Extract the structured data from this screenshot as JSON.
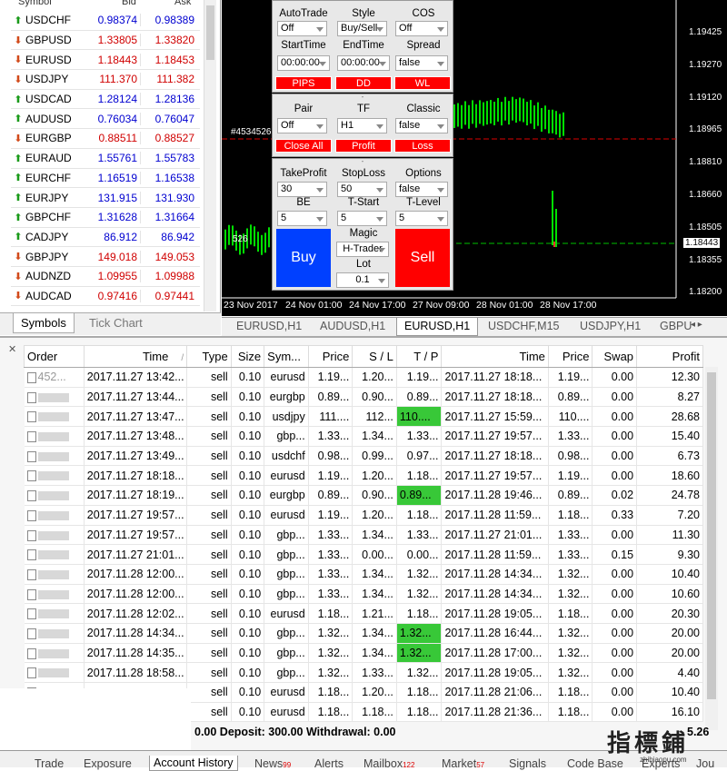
{
  "market_watch": {
    "columns": {
      "symbol": "Symbol",
      "bid": "Bid",
      "ask": "Ask"
    },
    "rows": [
      {
        "dir": "up",
        "symbol": "USDCHF",
        "bid": "0.98374",
        "ask": "0.98389",
        "color": "blue"
      },
      {
        "dir": "down",
        "symbol": "GBPUSD",
        "bid": "1.33805",
        "ask": "1.33820",
        "color": "red"
      },
      {
        "dir": "down",
        "symbol": "EURUSD",
        "bid": "1.18443",
        "ask": "1.18453",
        "color": "red"
      },
      {
        "dir": "down",
        "symbol": "USDJPY",
        "bid": "111.370",
        "ask": "111.382",
        "color": "red"
      },
      {
        "dir": "up",
        "symbol": "USDCAD",
        "bid": "1.28124",
        "ask": "1.28136",
        "color": "blue"
      },
      {
        "dir": "up",
        "symbol": "AUDUSD",
        "bid": "0.76034",
        "ask": "0.76047",
        "color": "blue"
      },
      {
        "dir": "down",
        "symbol": "EURGBP",
        "bid": "0.88511",
        "ask": "0.88527",
        "color": "red"
      },
      {
        "dir": "up",
        "symbol": "EURAUD",
        "bid": "1.55761",
        "ask": "1.55783",
        "color": "blue"
      },
      {
        "dir": "up",
        "symbol": "EURCHF",
        "bid": "1.16519",
        "ask": "1.16538",
        "color": "blue"
      },
      {
        "dir": "up",
        "symbol": "EURJPY",
        "bid": "131.915",
        "ask": "131.930",
        "color": "blue"
      },
      {
        "dir": "up",
        "symbol": "GBPCHF",
        "bid": "1.31628",
        "ask": "1.31664",
        "color": "blue"
      },
      {
        "dir": "up",
        "symbol": "CADJPY",
        "bid": "86.912",
        "ask": "86.942",
        "color": "blue"
      },
      {
        "dir": "down",
        "symbol": "GBPJPY",
        "bid": "149.018",
        "ask": "149.053",
        "color": "red"
      },
      {
        "dir": "down",
        "symbol": "AUDNZD",
        "bid": "1.09955",
        "ask": "1.09988",
        "color": "red"
      },
      {
        "dir": "down",
        "symbol": "AUDCAD",
        "bid": "0.97416",
        "ask": "0.97441",
        "color": "red"
      }
    ],
    "tabs": [
      "Symbols",
      "Tick Chart"
    ]
  },
  "chart": {
    "price_labels": [
      "1.19425",
      "1.19270",
      "1.19120",
      "1.18965",
      "1.18810",
      "1.18660",
      "1.18505",
      "1.18355",
      "1.18200"
    ],
    "current_price": "1.18443",
    "time_labels": [
      "23 Nov 2017",
      "24 Nov 01:00",
      "24 Nov 17:00",
      "27 Nov 09:00",
      "28 Nov 01:00",
      "28 Nov 17:00"
    ],
    "order_label": "#4534526",
    "side_label": "526"
  },
  "panel": {
    "labels1": [
      "AutoTrade",
      "Style",
      "COS"
    ],
    "values1": [
      "Off",
      "Buy/Sell",
      "Off"
    ],
    "labels2": [
      "StartTime",
      "EndTime",
      "Spread"
    ],
    "values2": [
      "00:00:00",
      "00:00:00",
      "false"
    ],
    "buttons1": [
      "PIPS",
      "DD",
      "WL"
    ],
    "labels3": [
      "Pair",
      "TF",
      "Classic"
    ],
    "values3": [
      "Off",
      "H1",
      "false"
    ],
    "buttons2": [
      "Close All",
      "Profit",
      "Loss"
    ],
    "labels4": [
      "TakeProfit",
      "StopLoss",
      "Options"
    ],
    "values4": [
      "30",
      "50",
      "false"
    ],
    "labels5": [
      "BE",
      "T-Start",
      "T-Level"
    ],
    "values5": [
      "5",
      "5",
      "5"
    ],
    "magic_label": "Magic",
    "magic_value": "H-Trader",
    "lot_label": "Lot",
    "lot_value": "0.1",
    "buy": "Buy",
    "sell": "Sell",
    "dash": "-"
  },
  "chart_tabs": [
    "EURUSD,H1",
    "AUDUSD,H1",
    "EURUSD,H1",
    "USDCHF,M15",
    "USDJPY,H1",
    "GBPU"
  ],
  "history": {
    "headers": [
      "Order",
      "Time",
      "Type",
      "Size",
      "Sym...",
      "Price",
      "S / L",
      "T / P",
      "Time",
      "Price",
      "Swap",
      "Profit"
    ],
    "sort_mark": "/",
    "first_order": "452...",
    "rows": [
      [
        "2017.11.27 13:42...",
        "sell",
        "0.10",
        "eurusd",
        "1.19...",
        "1.20...",
        "1.19...",
        "2017.11.27 18:18...",
        "1.19...",
        "0.00",
        "12.30"
      ],
      [
        "2017.11.27 13:44...",
        "sell",
        "0.10",
        "eurgbp",
        "0.89...",
        "0.90...",
        "0.89...",
        "2017.11.27 18:18...",
        "0.89...",
        "0.00",
        "8.27"
      ],
      [
        "2017.11.27 13:47...",
        "sell",
        "0.10",
        "usdjpy",
        "111....",
        "112...",
        "110....",
        "2017.11.27 15:59...",
        "110....",
        "0.00",
        "28.68"
      ],
      [
        "2017.11.27 13:48...",
        "sell",
        "0.10",
        "gbp...",
        "1.33...",
        "1.34...",
        "1.33...",
        "2017.11.27 19:57...",
        "1.33...",
        "0.00",
        "15.40"
      ],
      [
        "2017.11.27 13:49...",
        "sell",
        "0.10",
        "usdchf",
        "0.98...",
        "0.99...",
        "0.97...",
        "2017.11.27 18:18...",
        "0.98...",
        "0.00",
        "6.73"
      ],
      [
        "2017.11.27 18:18...",
        "sell",
        "0.10",
        "eurusd",
        "1.19...",
        "1.20...",
        "1.18...",
        "2017.11.27 19:57...",
        "1.19...",
        "0.00",
        "18.60"
      ],
      [
        "2017.11.27 18:19...",
        "sell",
        "0.10",
        "eurgbp",
        "0.89...",
        "0.90...",
        "0.89...",
        "2017.11.28 19:46...",
        "0.89...",
        "0.02",
        "24.78"
      ],
      [
        "2017.11.27 19:57...",
        "sell",
        "0.10",
        "eurusd",
        "1.19...",
        "1.20...",
        "1.18...",
        "2017.11.28 11:59...",
        "1.18...",
        "0.33",
        "7.20"
      ],
      [
        "2017.11.27 19:57...",
        "sell",
        "0.10",
        "gbp...",
        "1.33...",
        "1.34...",
        "1.33...",
        "2017.11.27 21:01...",
        "1.33...",
        "0.00",
        "11.30"
      ],
      [
        "2017.11.27 21:01...",
        "sell",
        "0.10",
        "gbp...",
        "1.33...",
        "0.00...",
        "0.00...",
        "2017.11.28 11:59...",
        "1.33...",
        "0.15",
        "9.30"
      ],
      [
        "2017.11.28 12:00...",
        "sell",
        "0.10",
        "gbp...",
        "1.33...",
        "1.34...",
        "1.32...",
        "2017.11.28 14:34...",
        "1.32...",
        "0.00",
        "10.40"
      ],
      [
        "2017.11.28 12:00...",
        "sell",
        "0.10",
        "gbp...",
        "1.33...",
        "1.34...",
        "1.32...",
        "2017.11.28 14:34...",
        "1.32...",
        "0.00",
        "10.60"
      ],
      [
        "2017.11.28 12:02...",
        "sell",
        "0.10",
        "eurusd",
        "1.18...",
        "1.21...",
        "1.18...",
        "2017.11.28 19:05...",
        "1.18...",
        "0.00",
        "20.30"
      ],
      [
        "2017.11.28 14:34...",
        "sell",
        "0.10",
        "gbp...",
        "1.32...",
        "1.34...",
        "1.32...",
        "2017.11.28 16:44...",
        "1.32...",
        "0.00",
        "20.00"
      ],
      [
        "2017.11.28 14:35...",
        "sell",
        "0.10",
        "gbp...",
        "1.32...",
        "1.34...",
        "1.32...",
        "2017.11.28 17:00...",
        "1.32...",
        "0.00",
        "20.00"
      ],
      [
        "2017.11.28 18:58...",
        "sell",
        "0.10",
        "gbp...",
        "1.32...",
        "1.33...",
        "1.32...",
        "2017.11.28 19:05...",
        "1.32...",
        "0.00",
        "4.40"
      ],
      [
        "",
        "sell",
        "0.10",
        "eurusd",
        "1.18...",
        "1.20...",
        "1.18...",
        "2017.11.28 21:06...",
        "1.18...",
        "0.00",
        "10.40"
      ],
      [
        "",
        "sell",
        "0.10",
        "eurusd",
        "1.18...",
        "1.18...",
        "1.18...",
        "2017.11.28 21:36...",
        "1.18...",
        "0.00",
        "16.10"
      ]
    ],
    "green_tp_rows": [
      2,
      6,
      13,
      14
    ],
    "summary": "0.00  Deposit: 300.00  Withdrawal: 0.00",
    "summary_profit": "5.26"
  },
  "bottom_tabs": [
    {
      "label": "Trade",
      "badge": ""
    },
    {
      "label": "Exposure",
      "badge": ""
    },
    {
      "label": "Account History",
      "badge": ""
    },
    {
      "label": "News",
      "badge": "99"
    },
    {
      "label": "Alerts",
      "badge": ""
    },
    {
      "label": "Mailbox",
      "badge": "122"
    },
    {
      "label": "Market",
      "badge": "57"
    },
    {
      "label": "Signals",
      "badge": ""
    },
    {
      "label": "Code Base",
      "badge": ""
    },
    {
      "label": "Experts",
      "badge": ""
    },
    {
      "label": "Jou",
      "badge": ""
    }
  ],
  "watermark": {
    "big": "指標鋪",
    "small": "zhibiaopu.com"
  },
  "colors": {
    "buy": "#0040ff",
    "sell": "#ff0000",
    "candle_up": "#00e000",
    "green_cell": "#38c838"
  }
}
